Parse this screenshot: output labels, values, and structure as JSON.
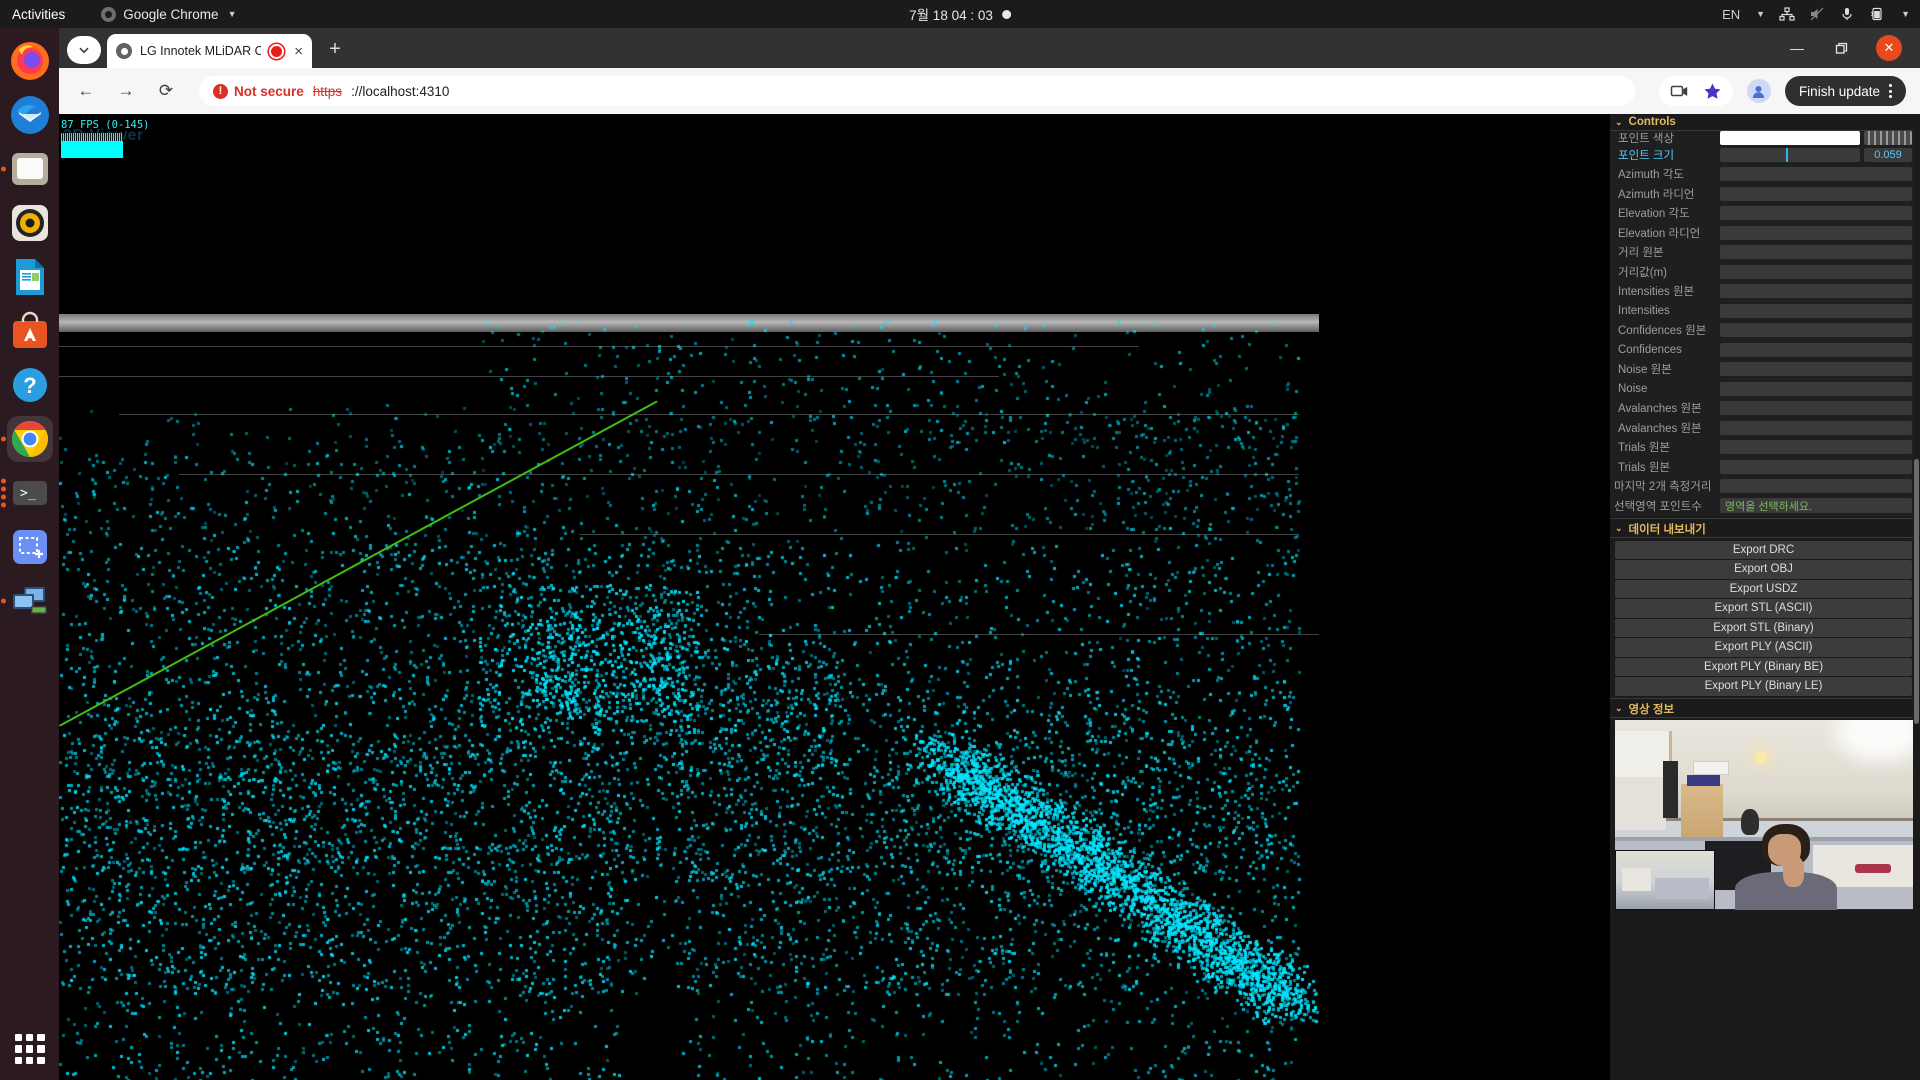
{
  "system_bar": {
    "activities": "Activities",
    "app_name": "Google Chrome",
    "app_icon": "chrome-icon",
    "caret_icon": "caret-down-icon",
    "clock": "7월 18  04 : 03",
    "recording_indicator": "recording-dot",
    "keyboard_layout": "EN",
    "tray_icons": [
      "network-icon",
      "volume-muted-icon",
      "microphone-icon",
      "battery-charging-icon",
      "caret-down-icon"
    ]
  },
  "dock": {
    "items": [
      {
        "name": "firefox",
        "running": false
      },
      {
        "name": "thunderbird",
        "running": false
      },
      {
        "name": "files",
        "running": true
      },
      {
        "name": "rhythmbox",
        "running": false
      },
      {
        "name": "libreoffice-writer",
        "running": false
      },
      {
        "name": "ubuntu-software",
        "running": false
      },
      {
        "name": "help",
        "running": false
      },
      {
        "name": "google-chrome",
        "running": true,
        "active": true
      },
      {
        "name": "terminal",
        "running": true,
        "instances": 4
      },
      {
        "name": "screenshot",
        "running": false
      },
      {
        "name": "remote-desktop",
        "running": true
      }
    ],
    "show_apps_label": "show-applications"
  },
  "browser": {
    "tab": {
      "title": "LG Innotek MLiDAR O",
      "recording_badge": "tab-recording-icon",
      "close_label": "×"
    },
    "new_tab_label": "+",
    "tab_list_icon": "chevron-down-icon",
    "window_controls": {
      "minimize": "—",
      "maximize": "❐",
      "close": "✕"
    },
    "toolbar": {
      "back_icon": "←",
      "forward_icon": "→",
      "reload_icon": "⟳",
      "security_label": "Not secure",
      "security_icon": "!",
      "url_scheme": "https",
      "url_rest": "://localhost:4310",
      "cast_icon": "screen-cast-icon",
      "bookmark_icon": "star-filled-icon",
      "profile_icon": "profile-avatar-icon",
      "finish_update_label": "Finish update",
      "menu_icon": "kebab-menu-icon"
    }
  },
  "viewer": {
    "stats_label": "87 FPS (0-145)",
    "title_watermark": "3D Viewer",
    "point_color": "#00e5ff",
    "axis_color": "#3fbf10",
    "background": "#000000"
  },
  "panel": {
    "controls": {
      "header": "Controls",
      "rows": [
        {
          "label": "포인트 색상",
          "type": "color",
          "value": "#ffffff"
        },
        {
          "label": "포인트 크기",
          "type": "slider",
          "value": "0.059",
          "active": true
        },
        {
          "label": "Azimuth 각도",
          "type": "field",
          "value": ""
        },
        {
          "label": "Azimuth 라디언",
          "type": "field",
          "value": ""
        },
        {
          "label": "Elevation 각도",
          "type": "field",
          "value": ""
        },
        {
          "label": "Elevation 라디언",
          "type": "field",
          "value": ""
        },
        {
          "label": "거리 원본",
          "type": "field",
          "value": ""
        },
        {
          "label": "거리값(m)",
          "type": "field",
          "value": ""
        },
        {
          "label": "Intensities 원본",
          "type": "field",
          "value": ""
        },
        {
          "label": "Intensities",
          "type": "field",
          "value": ""
        },
        {
          "label": "Confidences 원본",
          "type": "field",
          "value": ""
        },
        {
          "label": "Confidences",
          "type": "field",
          "value": ""
        },
        {
          "label": "Noise 원본",
          "type": "field",
          "value": ""
        },
        {
          "label": "Noise",
          "type": "field",
          "value": ""
        },
        {
          "label": "Avalanches 원본",
          "type": "field",
          "value": ""
        },
        {
          "label": "Avalanches 원본",
          "type": "field",
          "value": ""
        },
        {
          "label": "Trials 원본",
          "type": "field",
          "value": ""
        },
        {
          "label": "Trials 원본",
          "type": "field",
          "value": ""
        },
        {
          "label": "마지막 2개 측정거리",
          "type": "field",
          "value": ""
        },
        {
          "label": "선택영역 포인트수",
          "type": "field",
          "value": "영역을 선택하세요.",
          "value_color": "#7dbb5a"
        }
      ]
    },
    "export": {
      "header": "데이터 내보내기",
      "buttons": [
        "Export DRC",
        "Export OBJ",
        "Export USDZ",
        "Export STL (ASCII)",
        "Export STL (Binary)",
        "Export PLY (ASCII)",
        "Export PLY (Binary BE)",
        "Export PLY (Binary LE)"
      ]
    },
    "video": {
      "header": "영상 정보"
    }
  }
}
